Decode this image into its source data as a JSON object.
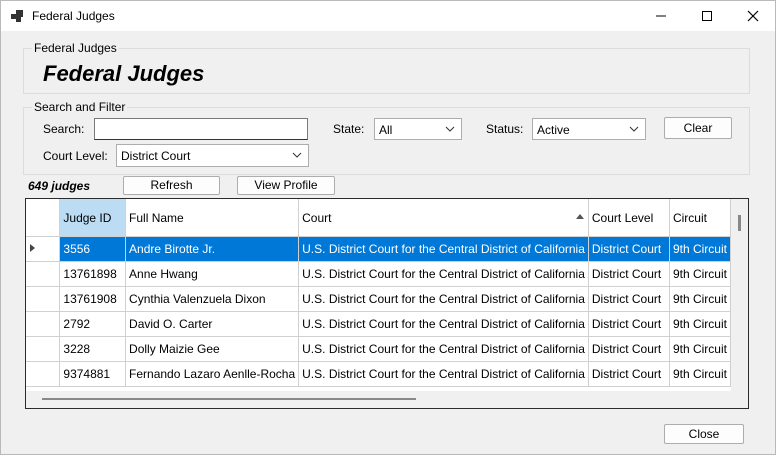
{
  "window": {
    "title": "Federal Judges"
  },
  "header": {
    "group_label": "Federal Judges",
    "title": "Federal Judges"
  },
  "filter": {
    "group_label": "Search and Filter",
    "search_label": "Search:",
    "search_value": "",
    "state_label": "State:",
    "state_value": "All",
    "status_label": "Status:",
    "status_value": "Active",
    "clear_label": "Clear",
    "court_level_label": "Court Level:",
    "court_level_value": "District Court"
  },
  "toolbar": {
    "count": "649 judges",
    "refresh_label": "Refresh",
    "view_profile_label": "View Profile"
  },
  "table": {
    "columns": [
      "Judge ID",
      "Full Name",
      "Court",
      "Court Level",
      "Circuit"
    ],
    "sorted_column": "Court",
    "rows": [
      [
        "3556",
        "Andre Birotte Jr.",
        "U.S. District Court for the Central District of California",
        "District Court",
        "9th Circuit"
      ],
      [
        "13761898",
        "Anne Hwang",
        "U.S. District Court for the Central District of California",
        "District Court",
        "9th Circuit"
      ],
      [
        "13761908",
        "Cynthia Valenzuela Dixon",
        "U.S. District Court for the Central District of California",
        "District Court",
        "9th Circuit"
      ],
      [
        "2792",
        "David O. Carter",
        "U.S. District Court for the Central District of California",
        "District Court",
        "9th Circuit"
      ],
      [
        "3228",
        "Dolly Maizie Gee",
        "U.S. District Court for the Central District of California",
        "District Court",
        "9th Circuit"
      ],
      [
        "9374881",
        "Fernando Lazaro Aenlle-Rocha",
        "U.S. District Court for the Central District of California",
        "District Court",
        "9th Circuit"
      ]
    ]
  },
  "footer": {
    "close_label": "Close"
  },
  "colors": {
    "selection": "#0078d7",
    "header_selected": "#bcdcf4"
  }
}
